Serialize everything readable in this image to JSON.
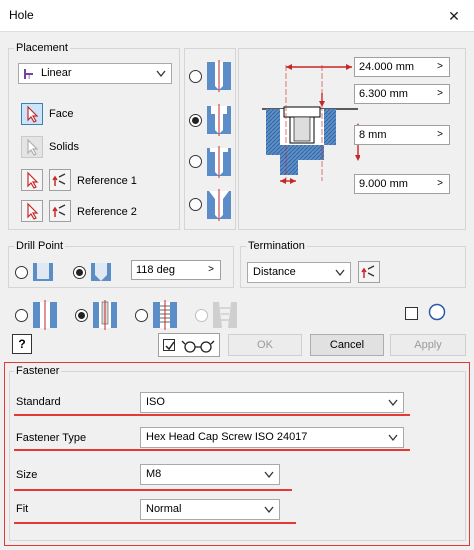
{
  "window": {
    "title": "Hole",
    "close_glyph": "✕"
  },
  "placement": {
    "group_label": "Placement",
    "method": "Linear",
    "face_label": "Face",
    "solids_label": "Solids",
    "reference1_label": "Reference 1",
    "reference2_label": "Reference 2"
  },
  "dimensions": {
    "d1": "24.000 mm",
    "d2": "6.300 mm",
    "d3": "8 mm",
    "d4": "9.000 mm"
  },
  "drill_point": {
    "group_label": "Drill Point",
    "angle": "118 deg"
  },
  "termination": {
    "group_label": "Termination",
    "value": "Distance"
  },
  "buttons": {
    "ok": "OK",
    "cancel": "Cancel",
    "apply": "Apply",
    "help_glyph": "?"
  },
  "fastener": {
    "group_label": "Fastener",
    "standard_label": "Standard",
    "standard_value": "ISO",
    "type_label": "Fastener Type",
    "type_value": "Hex Head Cap Screw ISO 24017",
    "size_label": "Size",
    "size_value": "M8",
    "fit_label": "Fit",
    "fit_value": "Normal"
  },
  "colors": {
    "accent_red": "#e53935",
    "selection_blue": "#cce4f7",
    "part_blue": "#5b8dc8"
  }
}
